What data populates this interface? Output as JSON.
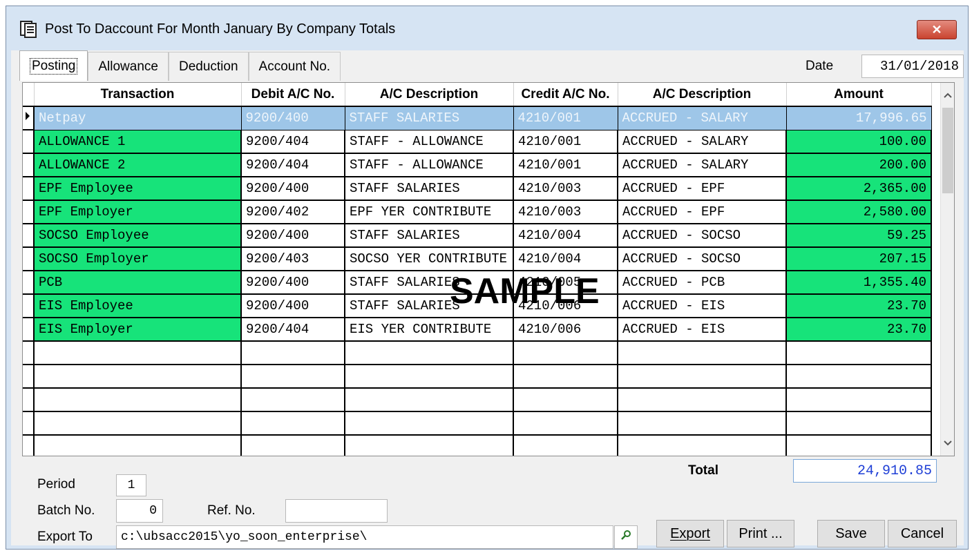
{
  "window": {
    "title": "Post To Daccount For Month January By Company Totals",
    "close_label": "✕"
  },
  "tabs": [
    {
      "label": "Posting",
      "active": true
    },
    {
      "label": "Allowance",
      "active": false
    },
    {
      "label": "Deduction",
      "active": false
    },
    {
      "label": "Account No.",
      "active": false
    }
  ],
  "date": {
    "label": "Date",
    "value": "31/01/2018"
  },
  "grid": {
    "columns": [
      "Transaction",
      "Debit A/C No.",
      "A/C Description",
      "Credit A/C No.",
      "A/C Description",
      "Amount"
    ],
    "rows": [
      {
        "transaction": "Netpay",
        "debit": "9200/400",
        "debit_desc": "STAFF SALARIES",
        "credit": "4210/001",
        "credit_desc": "ACCRUED - SALARY",
        "amount": "17,996.65"
      },
      {
        "transaction": "ALLOWANCE 1",
        "debit": "9200/404",
        "debit_desc": "STAFF - ALLOWANCE",
        "credit": "4210/001",
        "credit_desc": "ACCRUED - SALARY",
        "amount": "100.00"
      },
      {
        "transaction": "ALLOWANCE 2",
        "debit": "9200/404",
        "debit_desc": "STAFF - ALLOWANCE",
        "credit": "4210/001",
        "credit_desc": "ACCRUED - SALARY",
        "amount": "200.00"
      },
      {
        "transaction": "EPF Employee",
        "debit": "9200/400",
        "debit_desc": "STAFF SALARIES",
        "credit": "4210/003",
        "credit_desc": "ACCRUED - EPF",
        "amount": "2,365.00"
      },
      {
        "transaction": "EPF Employer",
        "debit": "9200/402",
        "debit_desc": "EPF YER CONTRIBUTE",
        "credit": "4210/003",
        "credit_desc": "ACCRUED - EPF",
        "amount": "2,580.00"
      },
      {
        "transaction": "SOCSO Employee",
        "debit": "9200/400",
        "debit_desc": "STAFF SALARIES",
        "credit": "4210/004",
        "credit_desc": "ACCRUED - SOCSO",
        "amount": "59.25"
      },
      {
        "transaction": "SOCSO Employer",
        "debit": "9200/403",
        "debit_desc": "SOCSO YER CONTRIBUTE",
        "credit": "4210/004",
        "credit_desc": "ACCRUED - SOCSO",
        "amount": "207.15"
      },
      {
        "transaction": "PCB",
        "debit": "9200/400",
        "debit_desc": "STAFF SALARIES",
        "credit": "4210/005",
        "credit_desc": "ACCRUED - PCB",
        "amount": "1,355.40"
      },
      {
        "transaction": "EIS Employee",
        "debit": "9200/400",
        "debit_desc": "STAFF SALARIES",
        "credit": "4210/006",
        "credit_desc": "ACCRUED - EIS",
        "amount": "23.70"
      },
      {
        "transaction": "EIS Employer",
        "debit": "9200/404",
        "debit_desc": "EIS YER CONTRIBUTE",
        "credit": "4210/006",
        "credit_desc": "ACCRUED - EIS",
        "amount": "23.70"
      }
    ],
    "row_colors": {
      "selected": "#9ec6e8",
      "highlight": "#17e37a"
    }
  },
  "watermark": "SAMPLE",
  "total": {
    "label": "Total",
    "value": "24,910.85"
  },
  "footer": {
    "period_label": "Period",
    "period_value": "1",
    "batch_label": "Batch No.",
    "batch_value": "0",
    "ref_label": "Ref. No.",
    "ref_value": "",
    "export_to_label": "Export To",
    "export_to_value": "c:\\ubsacc2015\\yo_soon_enterprise\\"
  },
  "buttons": {
    "export": "Export",
    "print": "Print ...",
    "save": "Save",
    "cancel": "Cancel"
  },
  "icons": {
    "title": "app-window-icon",
    "browse": "search-icon",
    "scroll_up": "chevron-up-icon",
    "scroll_down": "chevron-down-icon",
    "row_pointer": "row-pointer-icon"
  }
}
